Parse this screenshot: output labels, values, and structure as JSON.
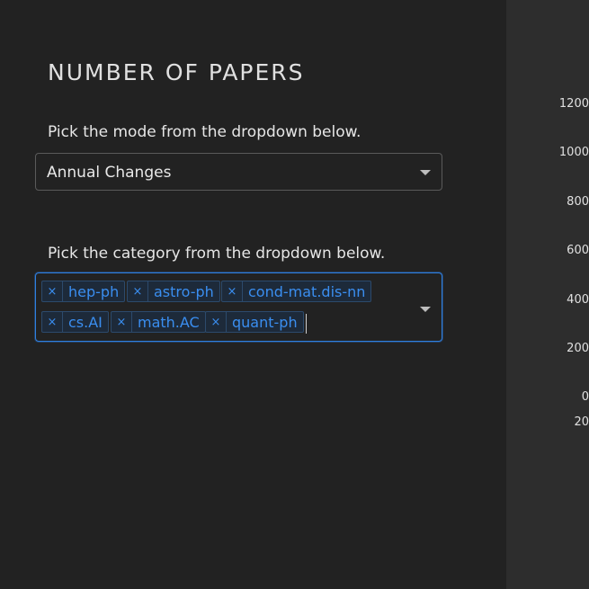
{
  "panel": {
    "title": "NUMBER OF PAPERS",
    "mode_label": "Pick the mode from the dropdown below.",
    "mode_value": "Annual Changes",
    "category_label": "Pick the category from the dropdown below.",
    "tags": [
      {
        "label": "hep-ph",
        "remove": "×"
      },
      {
        "label": "astro-ph",
        "remove": "×"
      },
      {
        "label": "cond-mat.dis-nn",
        "remove": "×"
      },
      {
        "label": "cs.AI",
        "remove": "×"
      },
      {
        "label": "math.AC",
        "remove": "×"
      },
      {
        "label": "quant-ph",
        "remove": "×"
      }
    ]
  },
  "chart_ticks": {
    "y": [
      "1200",
      "1000",
      "800",
      "600",
      "400",
      "200",
      "0"
    ],
    "x_first": "20"
  },
  "colors": {
    "background": "#222222",
    "accent": "#2f7fe0",
    "tag_text": "#3a8ef0"
  }
}
